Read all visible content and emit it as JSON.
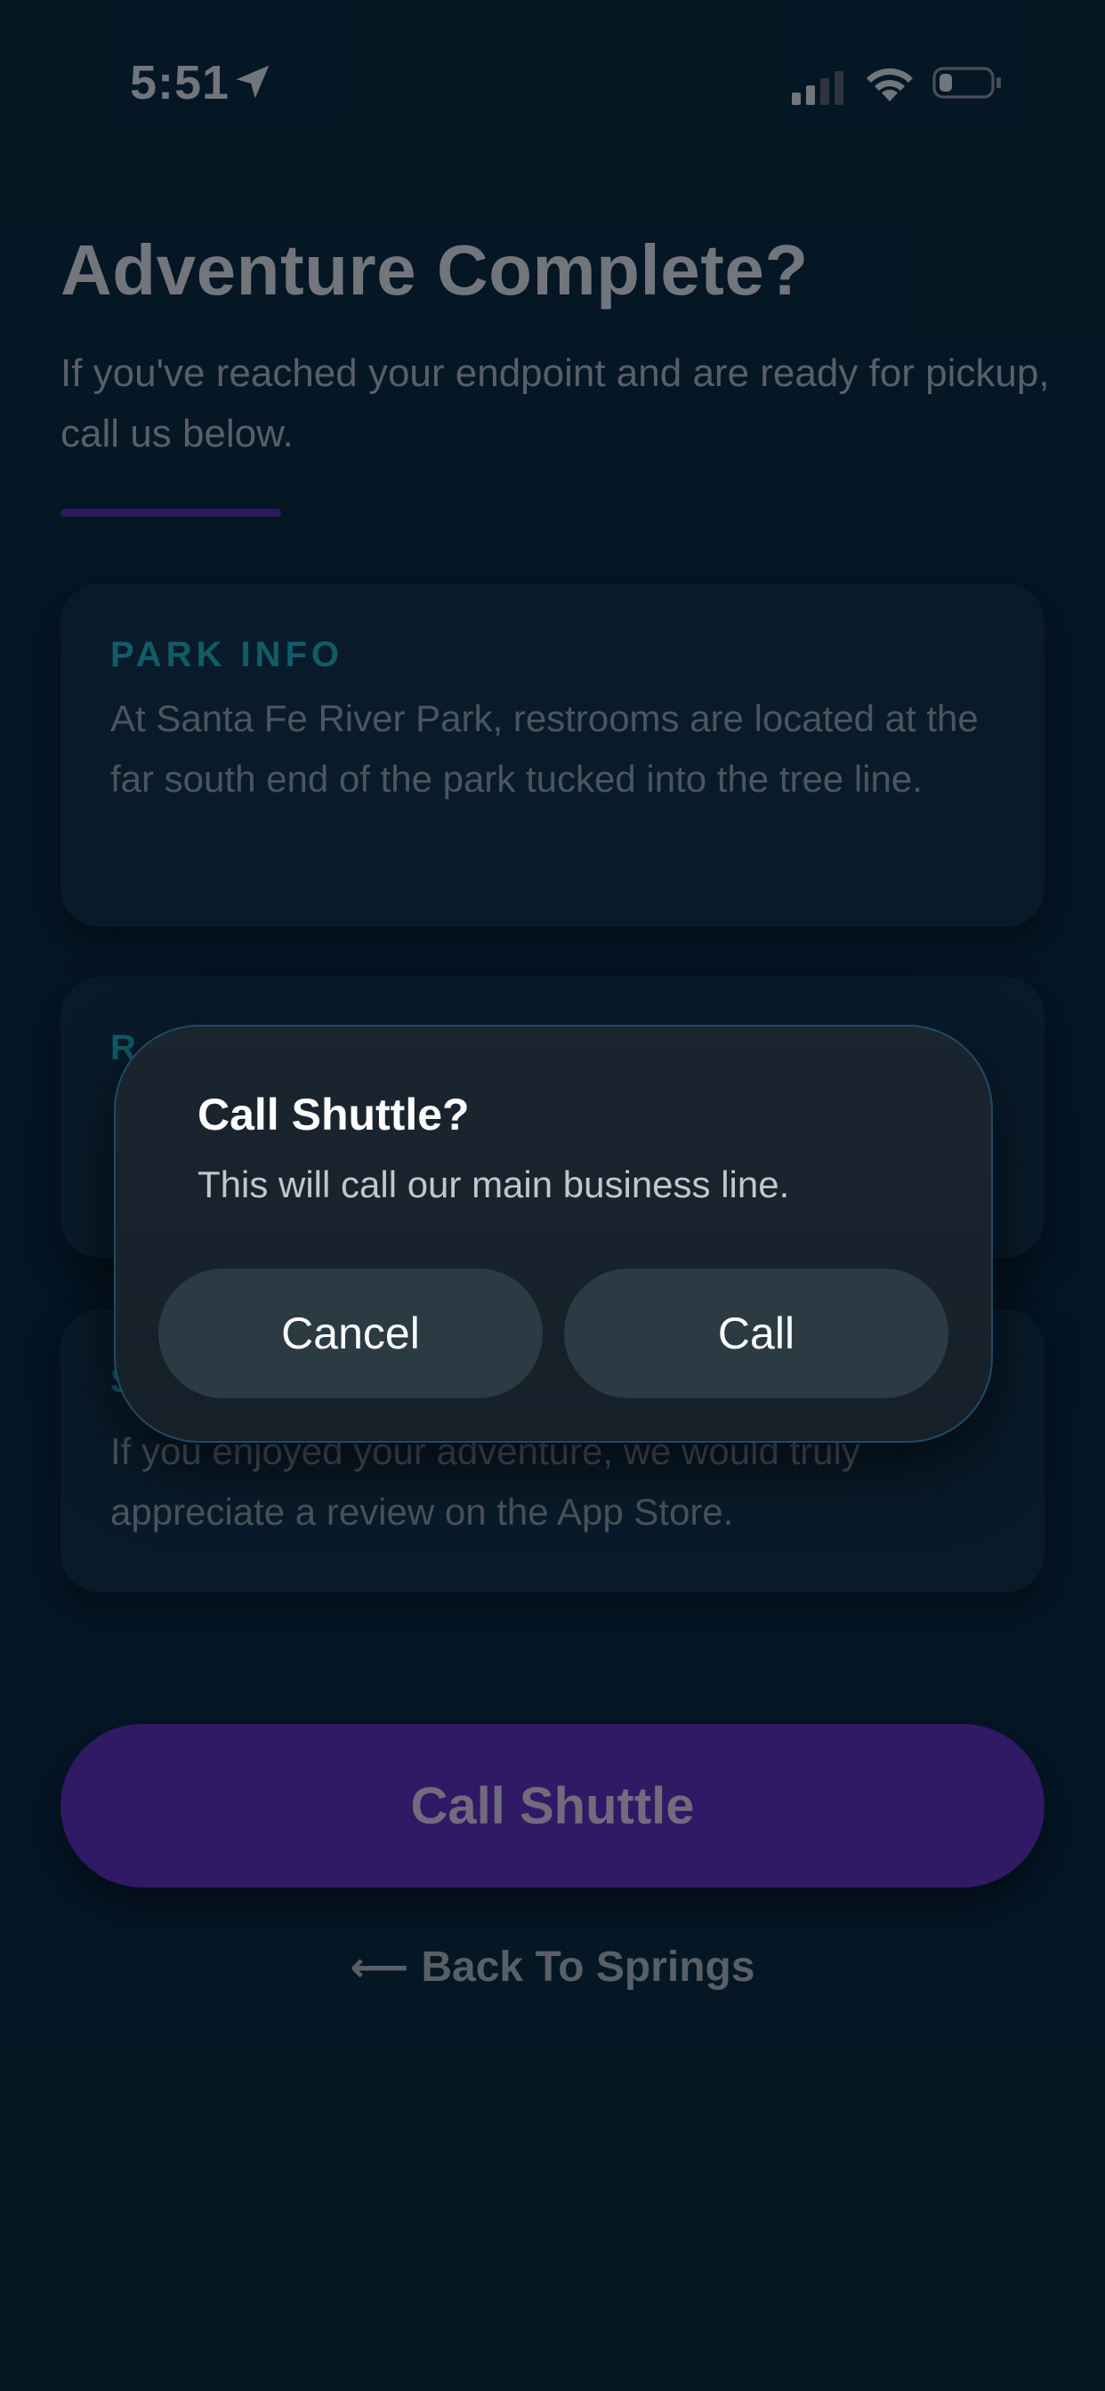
{
  "status_bar": {
    "time": "5:51",
    "icons": [
      "location-arrow-icon",
      "cellular-signal-icon",
      "wifi-icon",
      "battery-icon"
    ]
  },
  "page": {
    "title": "Adventure Complete?",
    "subtitle": "If you've reached your endpoint and are ready for pickup, call us below."
  },
  "cards": {
    "park_info": {
      "title": "PARK INFO",
      "text": "At Santa Fe River Park, restrooms are located at the far south end of the park tucked into the tree line."
    },
    "second": {
      "title": "R"
    },
    "review": {
      "title": "S",
      "text": "If you enjoyed your adventure, we would truly appreciate a review on the App Store."
    }
  },
  "actions": {
    "call_shuttle_label": "Call Shuttle",
    "back_arrow": "⟵",
    "back_label": "Back To Springs"
  },
  "alert": {
    "title": "Call Shuttle?",
    "message": "This will call our main business line.",
    "cancel_label": "Cancel",
    "call_label": "Call"
  },
  "colors": {
    "background": "#071a29",
    "card": "#0b2030",
    "accent_purple": "#3b1e78",
    "teal": "#17707a"
  }
}
